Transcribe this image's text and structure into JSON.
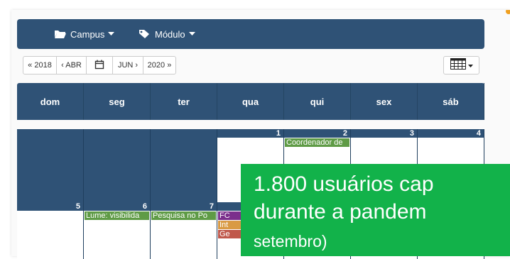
{
  "navbar": {
    "campus_label": "Campus",
    "modulo_label": "Módulo"
  },
  "toolbar": {
    "prev_year": "« 2018",
    "prev_month": "‹ ABR",
    "next_month": "JUN ›",
    "next_year": "2020 »"
  },
  "calendar": {
    "weekdays": [
      "dom",
      "seg",
      "ter",
      "qua",
      "qui",
      "sex",
      "sáb"
    ],
    "week1_days": [
      "",
      "",
      "",
      "1",
      "2",
      "3",
      "4"
    ],
    "week2_days": [
      "5",
      "6",
      "7"
    ],
    "events": {
      "thu2_event": "Coordenador de",
      "mon6_event": "Lume: visibilida",
      "tue7_event": "Pesquisa no Po",
      "wed8_e1": "FC",
      "wed8_e2": "Int",
      "wed8_e3": "Ge"
    },
    "event_colors": {
      "green": "#5f9b46",
      "purple": "#7b2f8c",
      "orange": "#d99a44",
      "red": "#c0584b"
    }
  },
  "overlay": {
    "line1": "1.800 usuários cap",
    "line2": "durante a pandem",
    "line3": "setembro)",
    "background": "#12b24a"
  },
  "colors": {
    "navy": "#2f5276"
  }
}
